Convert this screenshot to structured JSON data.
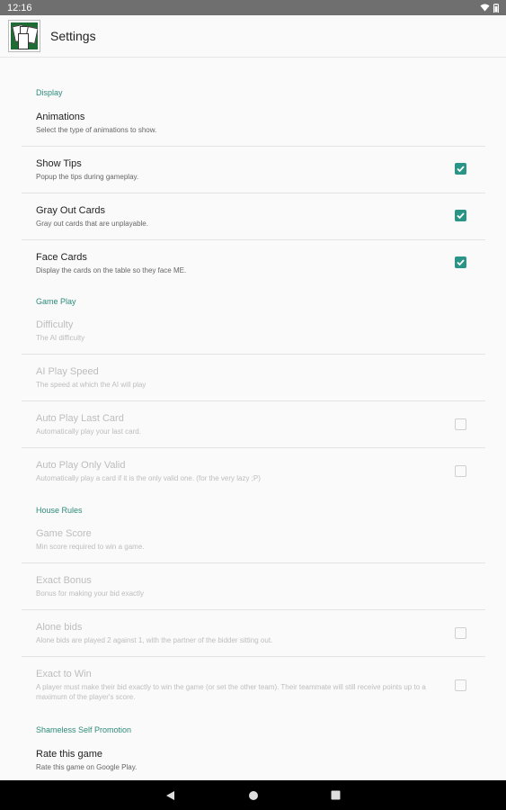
{
  "status": {
    "time": "12:16"
  },
  "app_bar": {
    "title": "Settings"
  },
  "sections": {
    "display": {
      "header": "Display"
    },
    "gameplay": {
      "header": "Game Play"
    },
    "house_rules": {
      "header": "House Rules"
    },
    "promo": {
      "header": "Shameless Self Promotion"
    }
  },
  "prefs": {
    "animations": {
      "title": "Animations",
      "summary": "Select the type of animations to show."
    },
    "show_tips": {
      "title": "Show Tips",
      "summary": "Popup the tips during gameplay.",
      "checked": true
    },
    "gray_out": {
      "title": "Gray Out Cards",
      "summary": "Gray out cards that are unplayable.",
      "checked": true
    },
    "face_cards": {
      "title": "Face Cards",
      "summary": "Display the cards on the table so they face ME.",
      "checked": true
    },
    "difficulty": {
      "title": "Difficulty",
      "summary": "The AI difficulty"
    },
    "ai_speed": {
      "title": "AI Play Speed",
      "summary": "The speed at which the AI will play"
    },
    "auto_last": {
      "title": "Auto Play Last Card",
      "summary": "Automatically play your last card.",
      "checked": false
    },
    "auto_valid": {
      "title": "Auto Play Only Valid",
      "summary": "Automatically play a card if it is the only valid one. (for the very lazy ;P)",
      "checked": false
    },
    "game_score": {
      "title": "Game Score",
      "summary": "Min score required to win a game."
    },
    "exact_bonus": {
      "title": "Exact Bonus",
      "summary": "Bonus for making your bid exactly"
    },
    "alone_bids": {
      "title": "Alone bids",
      "summary": "Alone bids are played 2 against 1, with the partner of the bidder sitting out.",
      "checked": false
    },
    "exact_win": {
      "title": "Exact to Win",
      "summary": "A player must make their bid exactly to win the game (or set the other team). Their teammate will still receive points up to a maximum of the player's score.",
      "checked": false
    },
    "rate": {
      "title": "Rate this game",
      "summary": "Rate this game on Google Play."
    }
  },
  "colors": {
    "accent": "#2a9587",
    "section_header": "#2e8b7a",
    "status_bar": "#6f6f6f"
  },
  "icons": {
    "wifi": "wifi-icon",
    "battery": "battery-icon",
    "back": "back-icon",
    "home": "home-icon",
    "recents": "recents-icon"
  }
}
